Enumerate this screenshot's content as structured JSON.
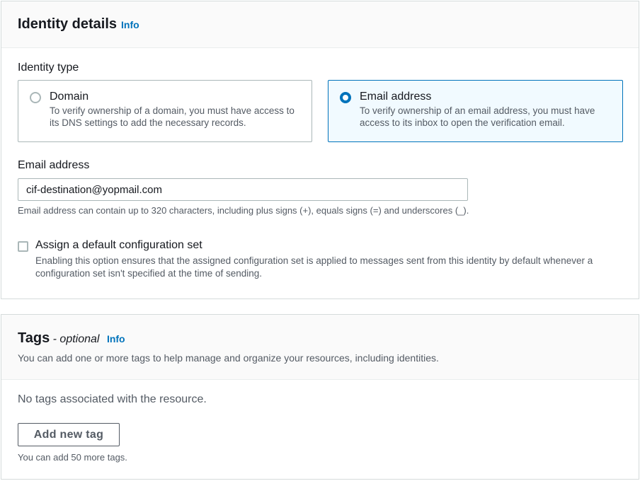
{
  "identity_panel": {
    "title": "Identity details",
    "info_link": "Info",
    "identity_type_label": "Identity type",
    "options": [
      {
        "title": "Domain",
        "description": "To verify ownership of a domain, you must have access to its DNS settings to add the necessary records.",
        "selected": false
      },
      {
        "title": "Email address",
        "description": "To verify ownership of an email address, you must have access to its inbox to open the verification email.",
        "selected": true
      }
    ],
    "email_label": "Email address",
    "email_value": "cif-destination@yopmail.com",
    "email_hint": "Email address can contain up to 320 characters, including plus signs (+), equals signs (=) and underscores (_).",
    "config_set_label": "Assign a default configuration set",
    "config_set_description": "Enabling this option ensures that the assigned configuration set is applied to messages sent from this identity by default whenever a configuration set isn't specified at the time of sending.",
    "config_set_checked": false
  },
  "tags_panel": {
    "title": "Tags",
    "optional": "- optional",
    "info_link": "Info",
    "description": "You can add one or more tags to help manage and organize your resources, including identities.",
    "empty_text": "No tags associated with the resource.",
    "add_button": "Add new tag",
    "limit_hint": "You can add 50 more tags."
  },
  "colors": {
    "accent": "#0073bb",
    "selected_tile_bg": "#f1faff",
    "border": "#aab7b8",
    "text_secondary": "#545b64"
  }
}
